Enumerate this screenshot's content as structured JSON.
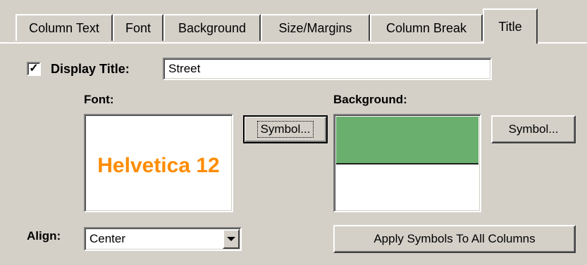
{
  "tabs": [
    {
      "label": "Column Text",
      "active": false
    },
    {
      "label": "Font",
      "active": false
    },
    {
      "label": "Background",
      "active": false
    },
    {
      "label": "Size/Margins",
      "active": false
    },
    {
      "label": "Column Break",
      "active": false
    },
    {
      "label": "Title",
      "active": true
    }
  ],
  "display_title": {
    "label": "Display Title:",
    "checked": true,
    "check_glyph": "✓",
    "value": "Street"
  },
  "font": {
    "label": "Font:",
    "sample": "Helvetica  12",
    "sample_color": "#ff8c00",
    "symbol_button": "Symbol..."
  },
  "background": {
    "label": "Background:",
    "swatch_color": "#6aaf6e",
    "symbol_button": "Symbol..."
  },
  "align": {
    "label": "Align:",
    "value": "Center"
  },
  "apply_button": "Apply Symbols To All Columns"
}
